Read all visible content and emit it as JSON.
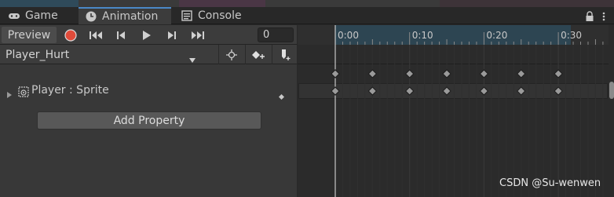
{
  "tabs": [
    {
      "label": "Game",
      "icon": "gamepad-icon"
    },
    {
      "label": "Animation",
      "icon": "clock-icon",
      "active": true
    },
    {
      "label": "Console",
      "icon": "list-icon"
    }
  ],
  "toolbar": {
    "preview_label": "Preview",
    "frame_value": "0"
  },
  "clip": {
    "name": "Player_Hurt"
  },
  "property": {
    "label": "Player : Sprite"
  },
  "add_property_label": "Add Property",
  "ruler_labels": [
    "0:00",
    "0:10",
    "0:20",
    "0:30"
  ],
  "keyframe_frames": [
    0,
    5,
    10,
    15,
    20,
    25,
    30
  ],
  "colors": {
    "accent": "#4a88c7",
    "record": "#e04b3a",
    "range": "#2d4552"
  },
  "watermark": "CSDN @Su-wenwen"
}
